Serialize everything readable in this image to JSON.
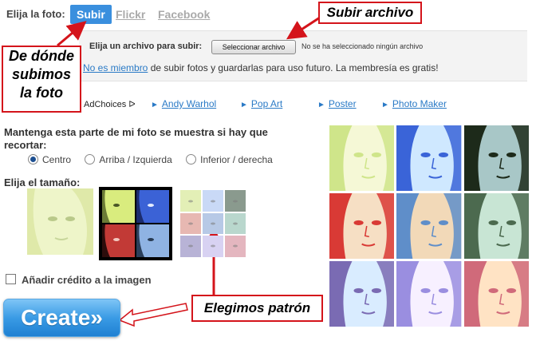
{
  "tabs": {
    "label": "Elija la foto:",
    "items": [
      "Subir",
      "Flickr",
      "Facebook"
    ]
  },
  "upload": {
    "prompt": "Elija un archivo para subir:",
    "button_label": "Seleccionar archivo",
    "status": "No se ha seleccionado ningún archivo",
    "member_link": "No es miembro",
    "member_text": " de subir fotos y guardarlas para uso futuro. La membresía es gratis!"
  },
  "annotations": {
    "left_line1": "De dónde",
    "left_line2": "subimos",
    "left_line3": "la foto",
    "top": "Subir archivo",
    "bottom": "Elegimos patrón"
  },
  "ads": {
    "adchoices": "AdChoices",
    "links": [
      "Andy Warhol",
      "Pop Art",
      "Poster",
      "Photo Maker"
    ]
  },
  "crop": {
    "question": "Mantenga esta parte de mi foto se muestra si hay que recortar:",
    "options": [
      "Centro",
      "Arriba / Izquierda",
      "Inferior / derecha"
    ],
    "selected": "Centro"
  },
  "size": {
    "label": "Elija el tamaño:"
  },
  "credit": {
    "label": "Añadir crédito a la imagen"
  },
  "create": {
    "label": "Create»"
  },
  "palette": {
    "accent": "#3a8fde",
    "callout_border": "#d4141b",
    "link": "#2a7ac6",
    "grid_colors": [
      [
        "#cfe58a",
        "#f5f8d6"
      ],
      [
        "#3a64d8",
        "#cfe8ff"
      ],
      [
        "#1d2a1a",
        "#a8c7c7"
      ],
      [
        "#d93a35",
        "#f6dfc4"
      ],
      [
        "#5f8ec9",
        "#f2d9b8"
      ],
      [
        "#4c6a4f",
        "#c8e5d4"
      ],
      [
        "#7a6bb3",
        "#d9ecff"
      ],
      [
        "#9a8ee0",
        "#f7f0ff"
      ],
      [
        "#d06a7a",
        "#ffe3c4"
      ]
    ]
  }
}
